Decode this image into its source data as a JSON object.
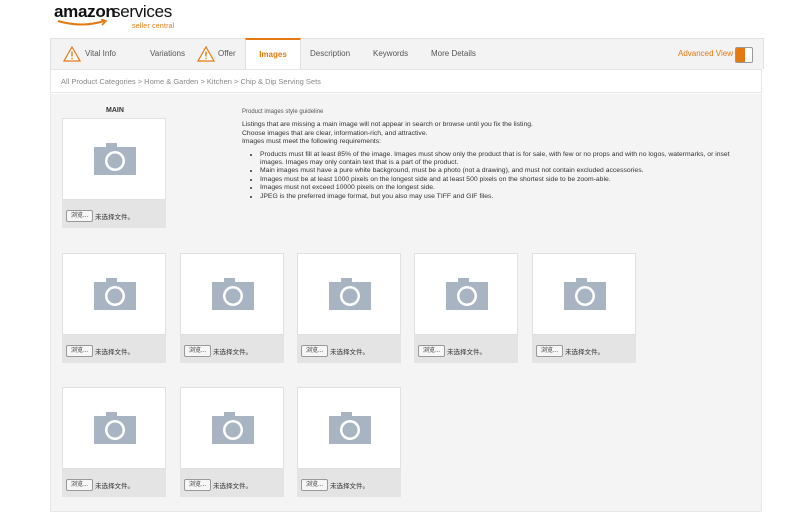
{
  "logo": {
    "brand": "amazon",
    "product": "services",
    "sub": "seller central"
  },
  "tabs": [
    {
      "label": "Vital Info",
      "warning": true
    },
    {
      "label": "Variations",
      "warning": false
    },
    {
      "label": "Offer",
      "warning": true
    },
    {
      "label": "Images",
      "warning": false,
      "active": true
    },
    {
      "label": "Description",
      "warning": false
    },
    {
      "label": "Keywords",
      "warning": false
    },
    {
      "label": "More Details",
      "warning": false
    }
  ],
  "advanced_view": {
    "label": "Advanced View",
    "on": true
  },
  "breadcrumb": "All Product Categories > Home & Garden > Kitchen > Chip & Dip Serving Sets",
  "main_label": "MAIN",
  "file": {
    "browse_label": "浏览...",
    "no_file": "未选择文件。"
  },
  "guideline": {
    "heading": "Product images style guideline",
    "paragraphs": [
      "Listings that are missing a main image will not appear in search or browse until you fix the listing.",
      "Choose images that are clear, information-rich, and attractive.",
      "Images must meet the following requirements:"
    ],
    "requirements": [
      "Products must fill at least 85% of the image. Images must show only the product that is for sale, with few or no props and with no logos, watermarks, or inset images. Images may only contain text that is a part of the product.",
      "Main images must have a pure white background, must be a photo (not a drawing), and must not contain excluded accessories.",
      "Images must be at least 1000 pixels on the longest side and at least 500 pixels on the shortest side to be zoom-able.",
      "Images must not exceed 10000 pixels on the longest side.",
      "JPEG is the preferred image format, but you also may use TIFF and GIF files."
    ]
  },
  "colors": {
    "accent": "#e47911",
    "panel": "#f4f4f4",
    "slot_bg": "#e4e4e4",
    "camera": "#a9b4c2"
  }
}
